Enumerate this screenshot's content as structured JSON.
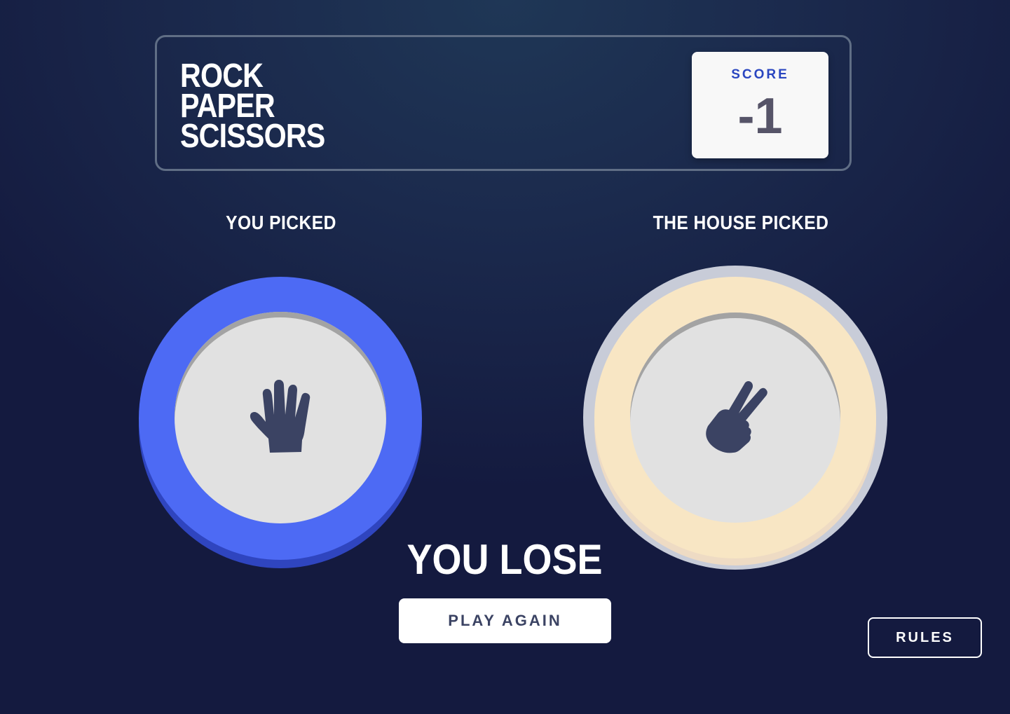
{
  "header": {
    "title_lines": [
      "ROCK",
      "PAPER",
      "SCISSORS"
    ],
    "score_label": "SCORE",
    "score_value": "-1"
  },
  "player": {
    "label": "YOU PICKED",
    "choice": "paper",
    "icon": "paper-hand-icon",
    "ring_color": "#4d6af4"
  },
  "house": {
    "label": "THE HOUSE PICKED",
    "choice": "scissors",
    "icon": "scissors-hand-icon",
    "ring_color": "#f8e6c4"
  },
  "result": {
    "text": "YOU LOSE",
    "play_again_label": "PLAY AGAIN"
  },
  "rules_label": "RULES",
  "colors": {
    "background": "#1b2a4d",
    "score_label": "#2a46c0",
    "score_value": "#565468",
    "icon": "#3b4363"
  }
}
